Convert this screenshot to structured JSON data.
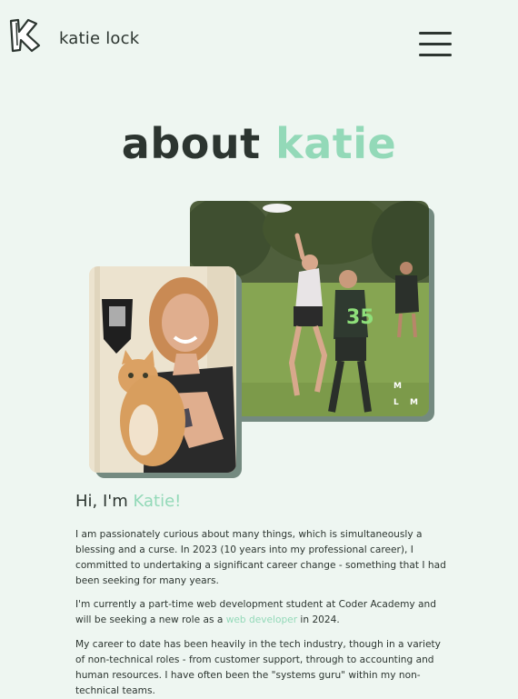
{
  "header": {
    "logo_letter": "K",
    "site_name": "katie lock",
    "menu_icon": "hamburger-menu-icon"
  },
  "page": {
    "title_dark": "about",
    "title_accent": "katie"
  },
  "photos": {
    "frisbee_alt": "Katie playing ultimate frisbee",
    "cat_alt": "Katie holding an orange cat",
    "watermark": "M L M"
  },
  "intro": {
    "greeting_prefix": "Hi, I'm",
    "greeting_name": "Katie!"
  },
  "bio": {
    "p1": "I am passionately curious about many things, which is simultaneously a blessing and a curse. In 2023 (10 years into my professional career), I committed to undertaking a significant career change - something that I had been seeking for many years.",
    "p2_before": "I'm currently a part-time web development student at Coder Academy and will be seeking a new role as a",
    "p2_link": "web developer",
    "p2_after": "in 2024.",
    "p3": "My career to date has been heavily in the tech industry, though in a variety of non-technical roles - from customer support, through to accounting and human resources. I have often been the \"systems guru\" within my non-technical teams."
  },
  "colors": {
    "background": "#eef6f1",
    "accent": "#93d9b8",
    "text": "#2c3530",
    "photo_shadow": "#748a80"
  }
}
